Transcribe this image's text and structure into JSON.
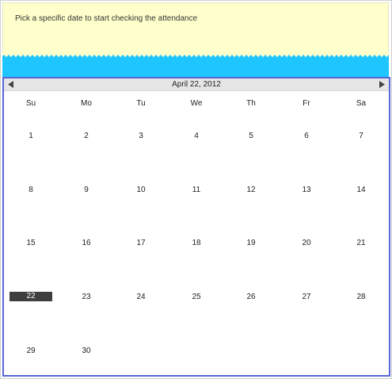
{
  "note": {
    "text": "Pick a specific date to start checking the attendance"
  },
  "calendar": {
    "title": "April 22, 2012",
    "prev_icon": "triangle-left-icon",
    "next_icon": "triangle-right-icon",
    "weekdays": [
      "Su",
      "Mo",
      "Tu",
      "We",
      "Th",
      "Fr",
      "Sa"
    ],
    "weeks": [
      [
        "1",
        "2",
        "3",
        "4",
        "5",
        "6",
        "7"
      ],
      [
        "8",
        "9",
        "10",
        "11",
        "12",
        "13",
        "14"
      ],
      [
        "15",
        "16",
        "17",
        "18",
        "19",
        "20",
        "21"
      ],
      [
        "22",
        "23",
        "24",
        "25",
        "26",
        "27",
        "28"
      ],
      [
        "29",
        "30",
        "",
        "",
        "",
        "",
        ""
      ]
    ],
    "selected_day": "22"
  },
  "colors": {
    "note_background": "#ffffcc",
    "band": "#1fc5ff",
    "calendar_border": "#5966d6",
    "selected_day_background": "#3f3f3f"
  }
}
